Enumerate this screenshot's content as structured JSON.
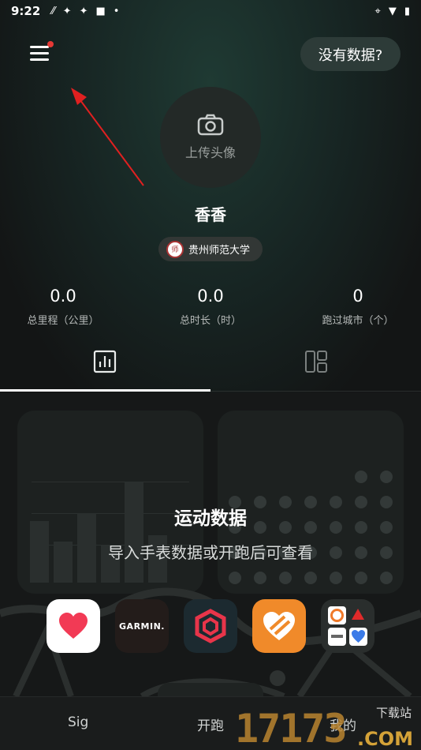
{
  "status_bar": {
    "time": "9:22",
    "icons": [
      "carrier-icon",
      "sync-icon",
      "sync-icon",
      "app-icon",
      "dot-icon"
    ],
    "right_icons": [
      "location-icon",
      "wifi-icon",
      "battery-icon"
    ]
  },
  "header": {
    "nodata_label": "没有数据?"
  },
  "profile": {
    "upload_label": "上传头像",
    "username": "香香",
    "school": "贵州师范大学",
    "school_logo_text": "师"
  },
  "stats": [
    {
      "value": "0.0",
      "label": "总里程（公里）"
    },
    {
      "value": "0.0",
      "label": "总时长（时）"
    },
    {
      "value": "0",
      "label": "跑过城市（个）"
    }
  ],
  "tabs": [
    "chart-tab",
    "layout-tab"
  ],
  "content": {
    "title": "运动数据",
    "subtitle": "导入手表数据或开跑后可查看",
    "apps": [
      "health",
      "garmin",
      "coros",
      "huawei-health",
      "more"
    ],
    "garmin_label": "GARMIN."
  },
  "bottom_nav": {
    "items": [
      "Sig",
      "开跑",
      "我的"
    ]
  },
  "watermark": {
    "digits": "17173",
    "site": "下载站",
    "com": ".COM"
  },
  "colors": {
    "accent_red": "#e53935",
    "background": "#141616",
    "badge_bg": "#323735"
  }
}
